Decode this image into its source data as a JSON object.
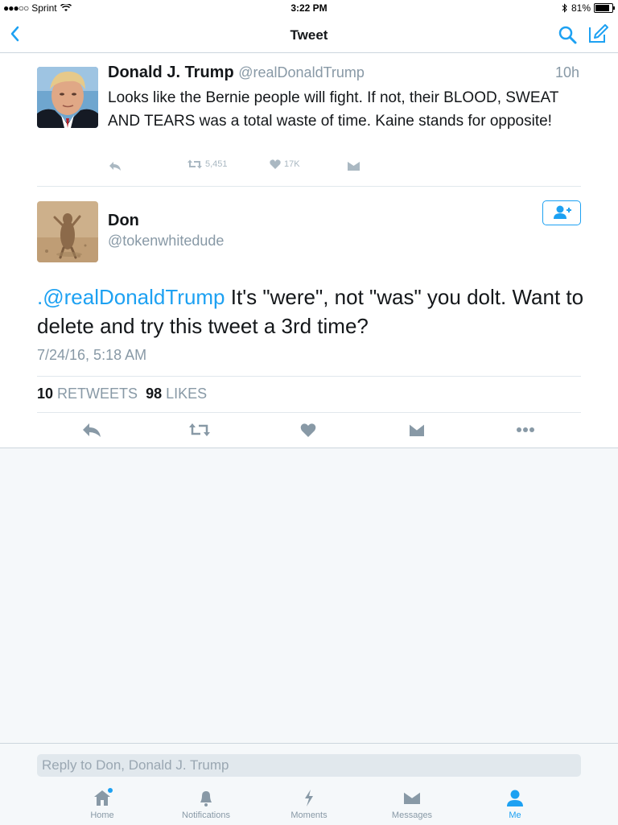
{
  "status_bar": {
    "carrier": "Sprint",
    "time": "3:22 PM",
    "battery_pct": "81%",
    "battery_level": 0.81
  },
  "nav": {
    "title": "Tweet",
    "icons": [
      "back-chevron-icon",
      "search-icon",
      "compose-icon"
    ]
  },
  "quoted_tweet": {
    "name": "Donald J. Trump",
    "handle": "@realDonaldTrump",
    "time": "10h",
    "text": "Looks like the Bernie people will fight. If not, their BLOOD, SWEAT AND TEARS was a total waste of time. Kaine stands for opposite!",
    "retweets": "5,451",
    "likes": "17K"
  },
  "main_tweet": {
    "name": "Don",
    "handle": "@tokenwhitedude",
    "mention": ".@realDonaldTrump",
    "text": " It's \"were\", not \"was\" you dolt. Want to delete and try this tweet a 3rd time?",
    "date": "7/24/16, 5:18 AM",
    "retweet_count": "10",
    "retweet_label": "RETWEETS",
    "like_count": "98",
    "like_label": "LIKES"
  },
  "reply": {
    "placeholder": "Reply to Don, Donald J. Trump"
  },
  "tabs": [
    {
      "label": "Home",
      "icon": "home-icon"
    },
    {
      "label": "Notifications",
      "icon": "bell-icon"
    },
    {
      "label": "Moments",
      "icon": "lightning-icon"
    },
    {
      "label": "Messages",
      "icon": "envelope-icon"
    },
    {
      "label": "Me",
      "icon": "person-icon",
      "active": true
    }
  ],
  "colors": {
    "accent": "#1da1f2",
    "muted": "#8899a6",
    "text": "#14171a",
    "background": "#f5f8fa"
  }
}
